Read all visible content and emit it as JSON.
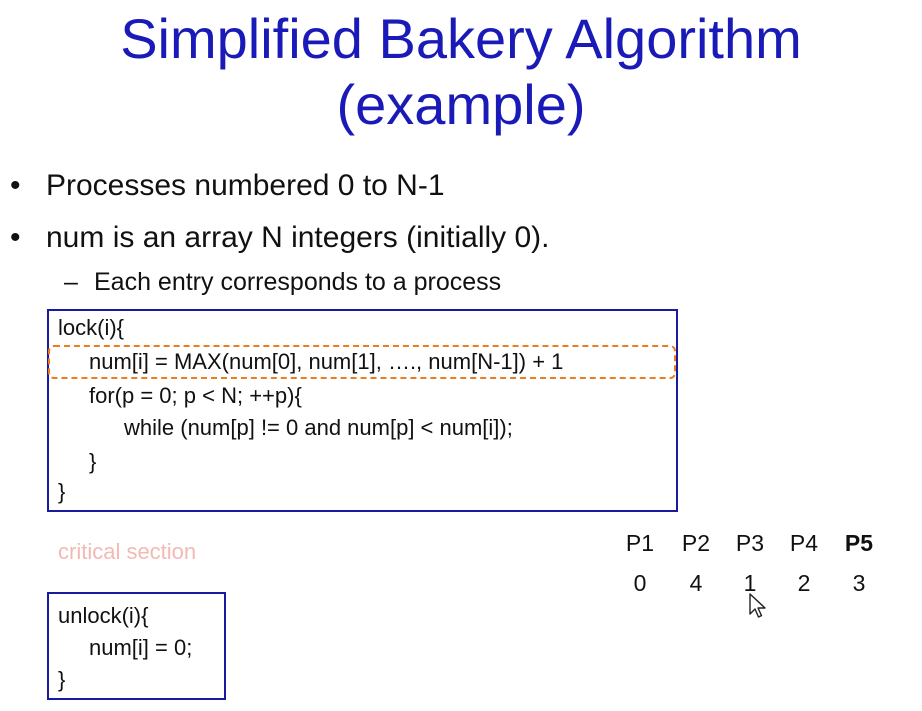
{
  "slide": {
    "title_line1": "Simplified Bakery Algorithm",
    "title_line2": "(example)",
    "bullets": [
      "Processes numbered 0 to N-1",
      "num is an array N integers (initially 0)."
    ],
    "sub_bullet": "Each entry corresponds to a process",
    "bullet_marker": "•",
    "dash_marker": "–"
  },
  "lock_code": {
    "lines": [
      "lock(i){",
      "num[i] = MAX(num[0], num[1], …., num[N-1]) + 1",
      "for(p = 0; p < N; ++p){",
      "while (num[p] != 0 and num[p] < num[i]);",
      "}",
      "}"
    ]
  },
  "critical_section": "critical section",
  "unlock_code": {
    "lines": [
      "unlock(i){",
      "num[i] = 0;",
      "}"
    ]
  },
  "processes": {
    "labels": [
      "P1",
      "P2",
      "P3",
      "P4",
      "P5"
    ],
    "values": [
      "0",
      "4",
      "1",
      "2",
      "3"
    ],
    "highlighted": "P5"
  },
  "colors": {
    "title": "#1a1ab8",
    "box_border": "#1a1aa0",
    "highlight_dash": "#f07b1a",
    "critical_text": "#f3b9b3"
  }
}
